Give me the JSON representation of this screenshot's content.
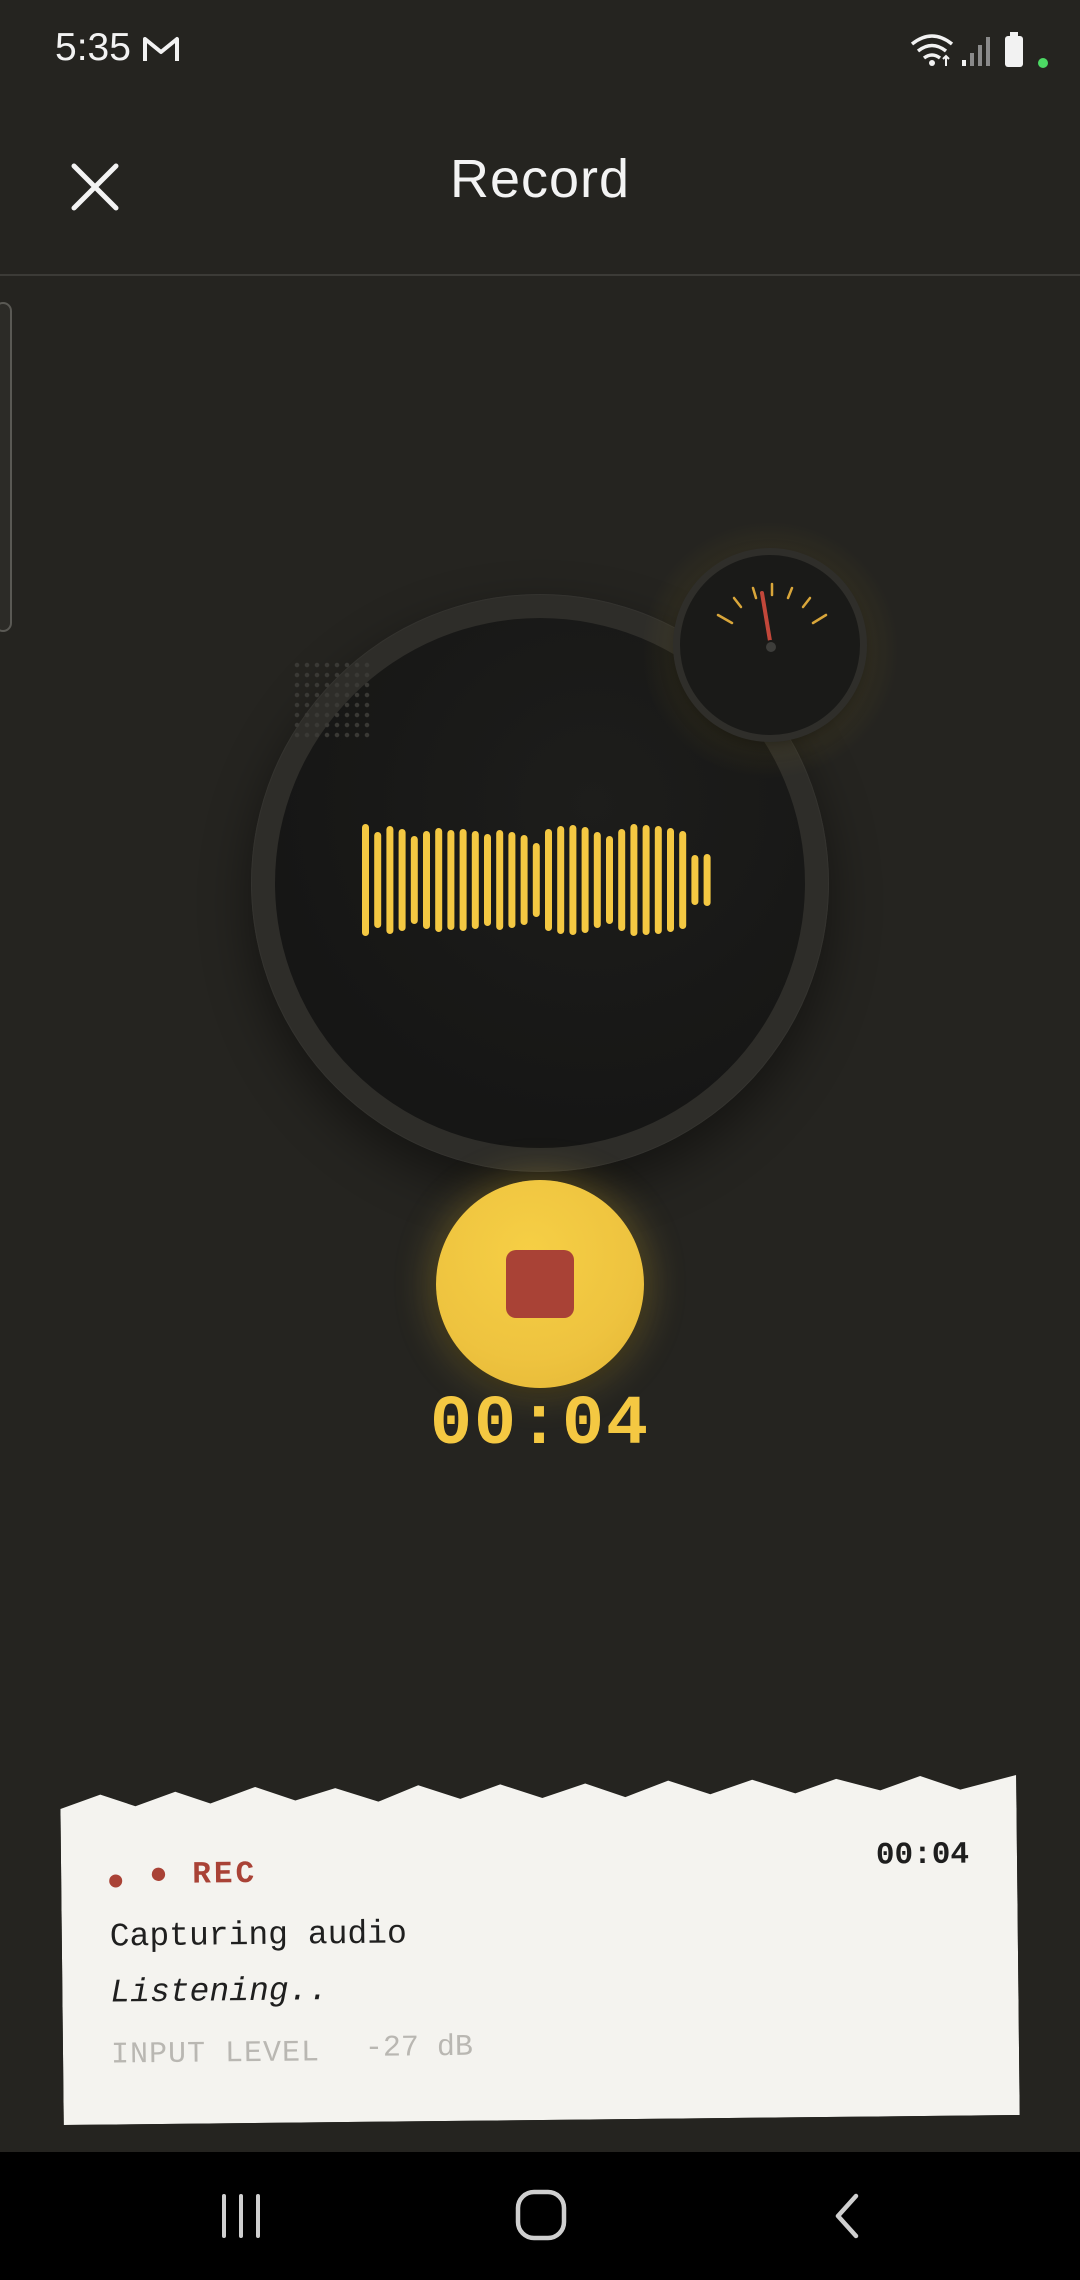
{
  "status_bar": {
    "time": "5:35",
    "icons": [
      "gmail-icon",
      "wifi-icon",
      "signal-icon",
      "battery-icon"
    ]
  },
  "header": {
    "title": "Record",
    "close_icon": "close-icon"
  },
  "recorder": {
    "timer": "00:04",
    "stop_icon": "stop-icon",
    "gauge_icon": "level-gauge-icon",
    "waveform_icon": "waveform-icon"
  },
  "info_card": {
    "rec_indicator": "● REC",
    "elapsed": "00:04",
    "status": "Capturing audio",
    "substatus": "Listening..",
    "input_level_label": "INPUT LEVEL",
    "input_level_value": "-27 dB"
  },
  "nav_bar": {
    "icons": [
      "recents-icon",
      "home-icon",
      "back-icon"
    ]
  },
  "colors": {
    "background": "#252420",
    "accent_yellow": "#f4c842",
    "rec_red": "#a94236",
    "paper": "#f4f3ef"
  }
}
